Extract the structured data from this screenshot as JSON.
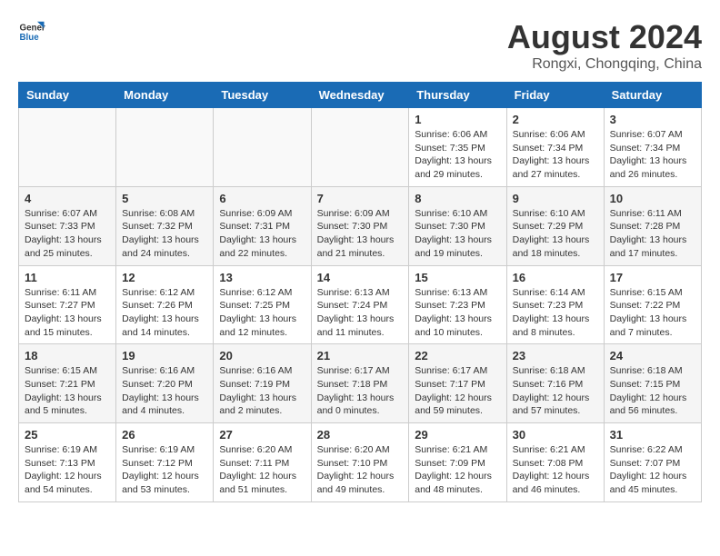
{
  "header": {
    "logo_general": "General",
    "logo_blue": "Blue",
    "month_year": "August 2024",
    "location": "Rongxi, Chongqing, China"
  },
  "weekdays": [
    "Sunday",
    "Monday",
    "Tuesday",
    "Wednesday",
    "Thursday",
    "Friday",
    "Saturday"
  ],
  "weeks": [
    [
      {
        "day": "",
        "info": ""
      },
      {
        "day": "",
        "info": ""
      },
      {
        "day": "",
        "info": ""
      },
      {
        "day": "",
        "info": ""
      },
      {
        "day": "1",
        "info": "Sunrise: 6:06 AM\nSunset: 7:35 PM\nDaylight: 13 hours\nand 29 minutes."
      },
      {
        "day": "2",
        "info": "Sunrise: 6:06 AM\nSunset: 7:34 PM\nDaylight: 13 hours\nand 27 minutes."
      },
      {
        "day": "3",
        "info": "Sunrise: 6:07 AM\nSunset: 7:34 PM\nDaylight: 13 hours\nand 26 minutes."
      }
    ],
    [
      {
        "day": "4",
        "info": "Sunrise: 6:07 AM\nSunset: 7:33 PM\nDaylight: 13 hours\nand 25 minutes."
      },
      {
        "day": "5",
        "info": "Sunrise: 6:08 AM\nSunset: 7:32 PM\nDaylight: 13 hours\nand 24 minutes."
      },
      {
        "day": "6",
        "info": "Sunrise: 6:09 AM\nSunset: 7:31 PM\nDaylight: 13 hours\nand 22 minutes."
      },
      {
        "day": "7",
        "info": "Sunrise: 6:09 AM\nSunset: 7:30 PM\nDaylight: 13 hours\nand 21 minutes."
      },
      {
        "day": "8",
        "info": "Sunrise: 6:10 AM\nSunset: 7:30 PM\nDaylight: 13 hours\nand 19 minutes."
      },
      {
        "day": "9",
        "info": "Sunrise: 6:10 AM\nSunset: 7:29 PM\nDaylight: 13 hours\nand 18 minutes."
      },
      {
        "day": "10",
        "info": "Sunrise: 6:11 AM\nSunset: 7:28 PM\nDaylight: 13 hours\nand 17 minutes."
      }
    ],
    [
      {
        "day": "11",
        "info": "Sunrise: 6:11 AM\nSunset: 7:27 PM\nDaylight: 13 hours\nand 15 minutes."
      },
      {
        "day": "12",
        "info": "Sunrise: 6:12 AM\nSunset: 7:26 PM\nDaylight: 13 hours\nand 14 minutes."
      },
      {
        "day": "13",
        "info": "Sunrise: 6:12 AM\nSunset: 7:25 PM\nDaylight: 13 hours\nand 12 minutes."
      },
      {
        "day": "14",
        "info": "Sunrise: 6:13 AM\nSunset: 7:24 PM\nDaylight: 13 hours\nand 11 minutes."
      },
      {
        "day": "15",
        "info": "Sunrise: 6:13 AM\nSunset: 7:23 PM\nDaylight: 13 hours\nand 10 minutes."
      },
      {
        "day": "16",
        "info": "Sunrise: 6:14 AM\nSunset: 7:23 PM\nDaylight: 13 hours\nand 8 minutes."
      },
      {
        "day": "17",
        "info": "Sunrise: 6:15 AM\nSunset: 7:22 PM\nDaylight: 13 hours\nand 7 minutes."
      }
    ],
    [
      {
        "day": "18",
        "info": "Sunrise: 6:15 AM\nSunset: 7:21 PM\nDaylight: 13 hours\nand 5 minutes."
      },
      {
        "day": "19",
        "info": "Sunrise: 6:16 AM\nSunset: 7:20 PM\nDaylight: 13 hours\nand 4 minutes."
      },
      {
        "day": "20",
        "info": "Sunrise: 6:16 AM\nSunset: 7:19 PM\nDaylight: 13 hours\nand 2 minutes."
      },
      {
        "day": "21",
        "info": "Sunrise: 6:17 AM\nSunset: 7:18 PM\nDaylight: 13 hours\nand 0 minutes."
      },
      {
        "day": "22",
        "info": "Sunrise: 6:17 AM\nSunset: 7:17 PM\nDaylight: 12 hours\nand 59 minutes."
      },
      {
        "day": "23",
        "info": "Sunrise: 6:18 AM\nSunset: 7:16 PM\nDaylight: 12 hours\nand 57 minutes."
      },
      {
        "day": "24",
        "info": "Sunrise: 6:18 AM\nSunset: 7:15 PM\nDaylight: 12 hours\nand 56 minutes."
      }
    ],
    [
      {
        "day": "25",
        "info": "Sunrise: 6:19 AM\nSunset: 7:13 PM\nDaylight: 12 hours\nand 54 minutes."
      },
      {
        "day": "26",
        "info": "Sunrise: 6:19 AM\nSunset: 7:12 PM\nDaylight: 12 hours\nand 53 minutes."
      },
      {
        "day": "27",
        "info": "Sunrise: 6:20 AM\nSunset: 7:11 PM\nDaylight: 12 hours\nand 51 minutes."
      },
      {
        "day": "28",
        "info": "Sunrise: 6:20 AM\nSunset: 7:10 PM\nDaylight: 12 hours\nand 49 minutes."
      },
      {
        "day": "29",
        "info": "Sunrise: 6:21 AM\nSunset: 7:09 PM\nDaylight: 12 hours\nand 48 minutes."
      },
      {
        "day": "30",
        "info": "Sunrise: 6:21 AM\nSunset: 7:08 PM\nDaylight: 12 hours\nand 46 minutes."
      },
      {
        "day": "31",
        "info": "Sunrise: 6:22 AM\nSunset: 7:07 PM\nDaylight: 12 hours\nand 45 minutes."
      }
    ]
  ]
}
